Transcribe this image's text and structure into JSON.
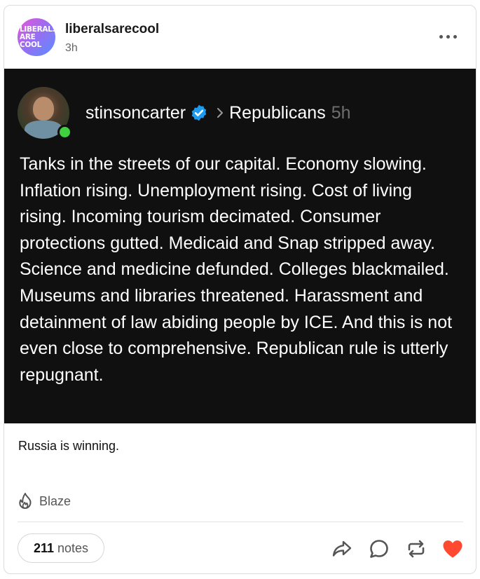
{
  "post": {
    "blog": {
      "name": "liberalsarecool",
      "avatar_lines": [
        "LIBERALS",
        "ARE",
        "COOL"
      ],
      "time": "3h"
    },
    "quoted": {
      "author": "stinsoncarter",
      "community": "Republicans",
      "time": "5h",
      "text": "Tanks in the streets of our capital. Economy slowing. Inflation rising. Unemployment rising. Cost of living rising. Incoming tourism decimated. Consumer protections gutted. Medicaid and Snap stripped away. Science and medicine defunded. Colleges blackmailed. Museums and libraries threatened. Harassment and detainment of law abiding people by ICE. And this is not even close to comprehensive. Republican rule is utterly repugnant."
    },
    "caption": "Russia is winning.",
    "blaze_label": "Blaze",
    "notes": {
      "count": "211",
      "label": "notes"
    },
    "icons": {
      "more": "more-dots-icon",
      "verified": "verified-badge-icon",
      "chevron": "chevron-right-icon",
      "blaze": "flame-icon",
      "share": "share-arrow-icon",
      "reply": "reply-bubble-icon",
      "reblog": "reblog-icon",
      "like": "heart-icon"
    },
    "colors": {
      "dark_block": "#101010",
      "like": "#ff4930",
      "verified": "#1d9bf0",
      "online": "#3fd13f"
    }
  }
}
